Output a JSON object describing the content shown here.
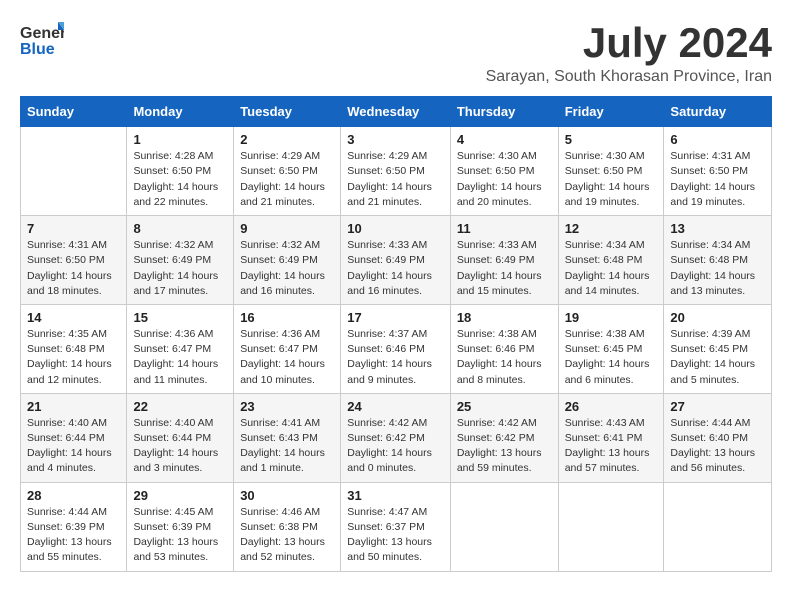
{
  "header": {
    "logo_line1": "General",
    "logo_line2": "Blue",
    "month": "July 2024",
    "location": "Sarayan, South Khorasan Province, Iran"
  },
  "weekdays": [
    "Sunday",
    "Monday",
    "Tuesday",
    "Wednesday",
    "Thursday",
    "Friday",
    "Saturday"
  ],
  "weeks": [
    [
      {
        "day": "",
        "info": ""
      },
      {
        "day": "1",
        "info": "Sunrise: 4:28 AM\nSunset: 6:50 PM\nDaylight: 14 hours\nand 22 minutes."
      },
      {
        "day": "2",
        "info": "Sunrise: 4:29 AM\nSunset: 6:50 PM\nDaylight: 14 hours\nand 21 minutes."
      },
      {
        "day": "3",
        "info": "Sunrise: 4:29 AM\nSunset: 6:50 PM\nDaylight: 14 hours\nand 21 minutes."
      },
      {
        "day": "4",
        "info": "Sunrise: 4:30 AM\nSunset: 6:50 PM\nDaylight: 14 hours\nand 20 minutes."
      },
      {
        "day": "5",
        "info": "Sunrise: 4:30 AM\nSunset: 6:50 PM\nDaylight: 14 hours\nand 19 minutes."
      },
      {
        "day": "6",
        "info": "Sunrise: 4:31 AM\nSunset: 6:50 PM\nDaylight: 14 hours\nand 19 minutes."
      }
    ],
    [
      {
        "day": "7",
        "info": "Sunrise: 4:31 AM\nSunset: 6:50 PM\nDaylight: 14 hours\nand 18 minutes."
      },
      {
        "day": "8",
        "info": "Sunrise: 4:32 AM\nSunset: 6:49 PM\nDaylight: 14 hours\nand 17 minutes."
      },
      {
        "day": "9",
        "info": "Sunrise: 4:32 AM\nSunset: 6:49 PM\nDaylight: 14 hours\nand 16 minutes."
      },
      {
        "day": "10",
        "info": "Sunrise: 4:33 AM\nSunset: 6:49 PM\nDaylight: 14 hours\nand 16 minutes."
      },
      {
        "day": "11",
        "info": "Sunrise: 4:33 AM\nSunset: 6:49 PM\nDaylight: 14 hours\nand 15 minutes."
      },
      {
        "day": "12",
        "info": "Sunrise: 4:34 AM\nSunset: 6:48 PM\nDaylight: 14 hours\nand 14 minutes."
      },
      {
        "day": "13",
        "info": "Sunrise: 4:34 AM\nSunset: 6:48 PM\nDaylight: 14 hours\nand 13 minutes."
      }
    ],
    [
      {
        "day": "14",
        "info": "Sunrise: 4:35 AM\nSunset: 6:48 PM\nDaylight: 14 hours\nand 12 minutes."
      },
      {
        "day": "15",
        "info": "Sunrise: 4:36 AM\nSunset: 6:47 PM\nDaylight: 14 hours\nand 11 minutes."
      },
      {
        "day": "16",
        "info": "Sunrise: 4:36 AM\nSunset: 6:47 PM\nDaylight: 14 hours\nand 10 minutes."
      },
      {
        "day": "17",
        "info": "Sunrise: 4:37 AM\nSunset: 6:46 PM\nDaylight: 14 hours\nand 9 minutes."
      },
      {
        "day": "18",
        "info": "Sunrise: 4:38 AM\nSunset: 6:46 PM\nDaylight: 14 hours\nand 8 minutes."
      },
      {
        "day": "19",
        "info": "Sunrise: 4:38 AM\nSunset: 6:45 PM\nDaylight: 14 hours\nand 6 minutes."
      },
      {
        "day": "20",
        "info": "Sunrise: 4:39 AM\nSunset: 6:45 PM\nDaylight: 14 hours\nand 5 minutes."
      }
    ],
    [
      {
        "day": "21",
        "info": "Sunrise: 4:40 AM\nSunset: 6:44 PM\nDaylight: 14 hours\nand 4 minutes."
      },
      {
        "day": "22",
        "info": "Sunrise: 4:40 AM\nSunset: 6:44 PM\nDaylight: 14 hours\nand 3 minutes."
      },
      {
        "day": "23",
        "info": "Sunrise: 4:41 AM\nSunset: 6:43 PM\nDaylight: 14 hours\nand 1 minute."
      },
      {
        "day": "24",
        "info": "Sunrise: 4:42 AM\nSunset: 6:42 PM\nDaylight: 14 hours\nand 0 minutes."
      },
      {
        "day": "25",
        "info": "Sunrise: 4:42 AM\nSunset: 6:42 PM\nDaylight: 13 hours\nand 59 minutes."
      },
      {
        "day": "26",
        "info": "Sunrise: 4:43 AM\nSunset: 6:41 PM\nDaylight: 13 hours\nand 57 minutes."
      },
      {
        "day": "27",
        "info": "Sunrise: 4:44 AM\nSunset: 6:40 PM\nDaylight: 13 hours\nand 56 minutes."
      }
    ],
    [
      {
        "day": "28",
        "info": "Sunrise: 4:44 AM\nSunset: 6:39 PM\nDaylight: 13 hours\nand 55 minutes."
      },
      {
        "day": "29",
        "info": "Sunrise: 4:45 AM\nSunset: 6:39 PM\nDaylight: 13 hours\nand 53 minutes."
      },
      {
        "day": "30",
        "info": "Sunrise: 4:46 AM\nSunset: 6:38 PM\nDaylight: 13 hours\nand 52 minutes."
      },
      {
        "day": "31",
        "info": "Sunrise: 4:47 AM\nSunset: 6:37 PM\nDaylight: 13 hours\nand 50 minutes."
      },
      {
        "day": "",
        "info": ""
      },
      {
        "day": "",
        "info": ""
      },
      {
        "day": "",
        "info": ""
      }
    ]
  ]
}
